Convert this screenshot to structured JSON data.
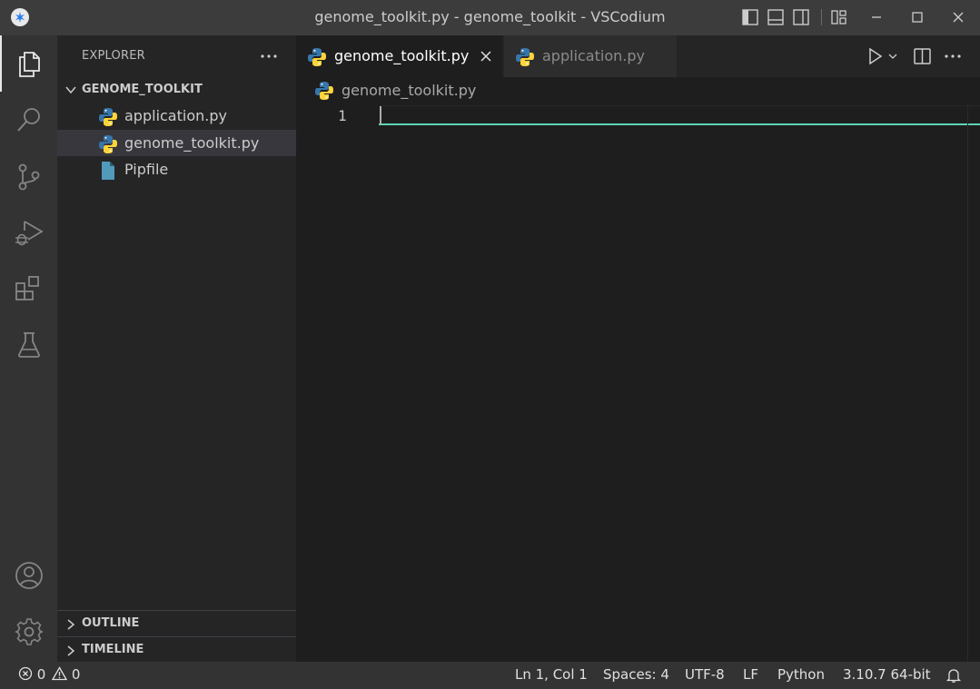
{
  "window": {
    "title": "genome_toolkit.py - genome_toolkit - VSCodium"
  },
  "activity_bar": {
    "items": [
      "files-icon",
      "search-icon",
      "source-control-icon",
      "run-debug-icon",
      "extensions-icon",
      "testing-icon"
    ],
    "bottom_items": [
      "account-icon",
      "settings-gear-icon"
    ]
  },
  "sidebar": {
    "title": "EXPLORER",
    "folder": "GENOME_TOOLKIT",
    "files": [
      {
        "name": "application.py",
        "icon": "python-file-icon"
      },
      {
        "name": "genome_toolkit.py",
        "icon": "python-file-icon",
        "selected": true
      },
      {
        "name": "Pipfile",
        "icon": "generic-file-icon"
      }
    ],
    "sections": [
      "OUTLINE",
      "TIMELINE"
    ]
  },
  "editor": {
    "tabs": [
      {
        "label": "genome_toolkit.py",
        "active": true
      },
      {
        "label": "application.py",
        "active": false
      }
    ],
    "breadcrumb": "genome_toolkit.py",
    "line_numbers": [
      "1"
    ],
    "lines": [
      ""
    ]
  },
  "status_bar": {
    "errors": "0",
    "warnings": "0",
    "position": "Ln 1, Col 1",
    "indentation": "Spaces: 4",
    "encoding": "UTF-8",
    "eol": "LF",
    "language": "Python",
    "interpreter": "3.10.7 64-bit"
  },
  "colors": {
    "accent": "#5fd3b2",
    "python_blue": "#3776ab",
    "python_yellow": "#ffd43b",
    "file_blue": "#519aba"
  }
}
